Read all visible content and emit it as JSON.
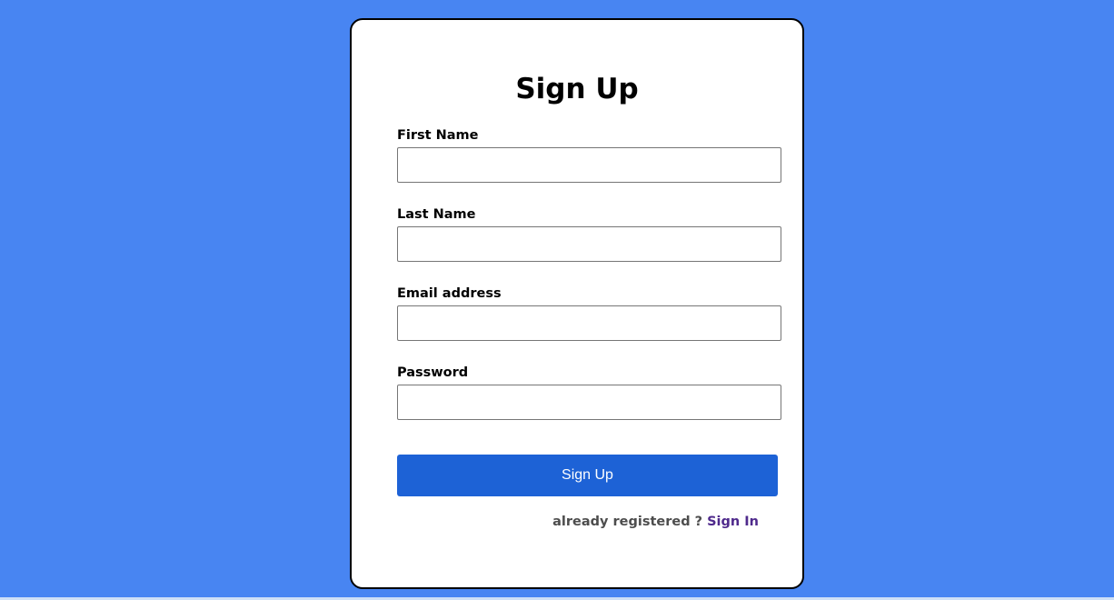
{
  "form": {
    "title": "Sign Up",
    "fields": [
      {
        "label": "First Name",
        "value": "",
        "placeholder": ""
      },
      {
        "label": "Last Name",
        "value": "",
        "placeholder": ""
      },
      {
        "label": "Email address",
        "value": "",
        "placeholder": ""
      },
      {
        "label": "Password",
        "value": "",
        "placeholder": ""
      }
    ],
    "submit_label": "Sign Up",
    "footer": {
      "prompt": "already registered ?",
      "link_label": "Sign In"
    }
  },
  "colors": {
    "background": "#4885f2",
    "card": "#ffffff",
    "button": "#1d62d6",
    "link": "#4f2a8c"
  }
}
